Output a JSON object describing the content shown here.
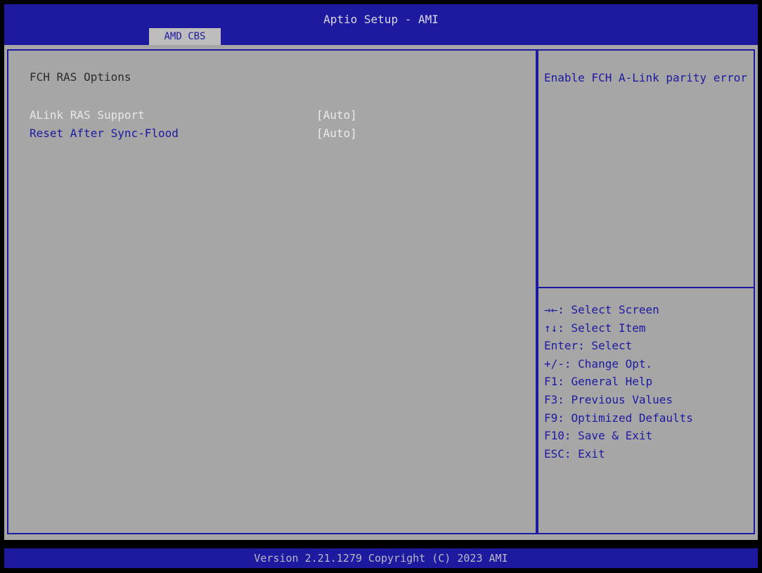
{
  "header": {
    "title": "Aptio Setup - AMI",
    "tab": "AMD CBS"
  },
  "main": {
    "section_title": "FCH RAS Options",
    "options": [
      {
        "label": "ALink RAS Support",
        "value": "[Auto]"
      },
      {
        "label": "Reset After Sync-Flood",
        "value": "[Auto]"
      }
    ]
  },
  "help": {
    "text": "Enable FCH A-Link parity error"
  },
  "keys": [
    "→←: Select Screen",
    "↑↓: Select Item",
    "Enter: Select",
    "+/-: Change Opt.",
    "F1: General Help",
    "F3: Previous Values",
    "F9: Optimized Defaults",
    "F10: Save & Exit",
    "ESC: Exit"
  ],
  "footer": {
    "text": "Version 2.21.1279 Copyright (C) 2023 AMI"
  },
  "colors": {
    "bios_blue": "#1e1aa0",
    "panel_gray": "#a6a6a6",
    "selected_text": "#e8e8e8"
  }
}
